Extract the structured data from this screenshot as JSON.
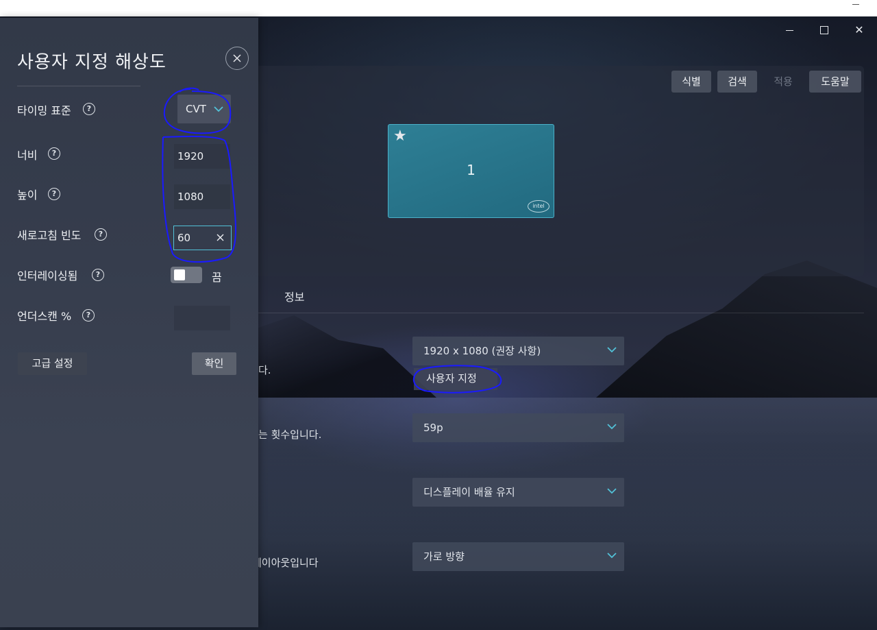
{
  "window": {
    "minimize_icon": "minimize-icon",
    "maximize_icon": "maximize-icon",
    "close_icon": "close-icon",
    "close_glyph": "✕"
  },
  "toolbar": {
    "identify": "식별",
    "detect": "검색",
    "apply": "적용",
    "help": "도움말"
  },
  "preview": {
    "monitor_number": "1",
    "star": "★",
    "brand": "intel"
  },
  "tabs": {
    "info": "정보"
  },
  "settings": {
    "resolution": "1920 x 1080 (권장 사항)",
    "custom_option": "사용자 지정",
    "resolution_desc_fragment": "다.",
    "refresh_desc_fragment": "는 횟수입니다.",
    "refresh_rate": "59p",
    "scaling": "디스플레이 배율 유지",
    "orientation_desc_fragment": "레이아웃입니다",
    "orientation": "가로 방향"
  },
  "flyout": {
    "title": "사용자 지정 해상도",
    "timing_label": "타이밍 표준",
    "timing_value": "CVT",
    "width_label": "너비",
    "width_value": "1920",
    "height_label": "높이",
    "height_value": "1080",
    "refresh_label": "새로고침 빈도",
    "refresh_value": "60",
    "interlaced_label": "인터레이싱됨",
    "interlaced_state": "끔",
    "underscan_label": "언더스캔 %",
    "advanced_button": "고급 설정",
    "ok_button": "확인",
    "help_glyph": "?"
  },
  "colors": {
    "accent": "#52c2d8",
    "annotation": "#1a1aff",
    "panel": "#363d4d"
  }
}
